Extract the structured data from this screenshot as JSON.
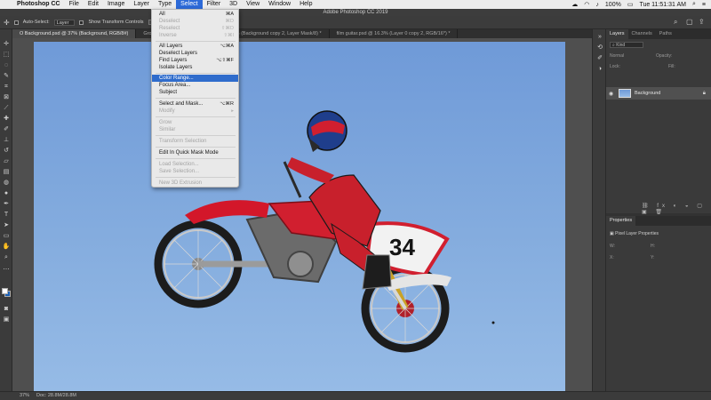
{
  "menubar": {
    "app_name": "Photoshop CC",
    "items": [
      "File",
      "Edit",
      "Image",
      "Layer",
      "Type",
      "Select",
      "Filter",
      "3D",
      "View",
      "Window",
      "Help"
    ],
    "active": "Select",
    "battery": "100%",
    "clock": "Tue 11:51:31 AM"
  },
  "window_title": "Adobe Photoshop CC 2019",
  "options_bar": {
    "auto_select_label": "Auto-Select:",
    "auto_select_value": "Layer",
    "transform_controls_label": "Show Transform Controls"
  },
  "doc_tabs": [
    "O Background.psd @ 37% (Background, RGB/8#)",
    "Group 1...",
    "gameofthrones.psd @ 20% (Background copy 2, Layer Mask/8) *",
    "film guitar.psd @ 16.3% (Layer 0 copy 2, RGB/16*) *"
  ],
  "select_menu": {
    "items": [
      {
        "label": "All",
        "shortcut": "⌘A",
        "enabled": true
      },
      {
        "label": "Deselect",
        "shortcut": "⌘D",
        "enabled": false
      },
      {
        "label": "Reselect",
        "shortcut": "⇧⌘D",
        "enabled": false
      },
      {
        "label": "Inverse",
        "shortcut": "⇧⌘I",
        "enabled": false
      },
      {
        "label": "All Layers",
        "shortcut": "⌥⌘A",
        "enabled": true
      },
      {
        "label": "Deselect Layers",
        "shortcut": "",
        "enabled": true
      },
      {
        "label": "Find Layers",
        "shortcut": "⌥⇧⌘F",
        "enabled": true
      },
      {
        "label": "Isolate Layers",
        "shortcut": "",
        "enabled": true
      },
      {
        "label": "Color Range...",
        "shortcut": "",
        "enabled": true,
        "highlighted": true
      },
      {
        "label": "Focus Area...",
        "shortcut": "",
        "enabled": true
      },
      {
        "label": "Subject",
        "shortcut": "",
        "enabled": true
      },
      {
        "label": "Select and Mask...",
        "shortcut": "⌥⌘R",
        "enabled": true
      },
      {
        "label": "Modify",
        "shortcut": "▸",
        "enabled": false
      },
      {
        "label": "Grow",
        "shortcut": "",
        "enabled": false
      },
      {
        "label": "Similar",
        "shortcut": "",
        "enabled": false
      },
      {
        "label": "Transform Selection",
        "shortcut": "",
        "enabled": false
      },
      {
        "label": "Edit In Quick Mask Mode",
        "shortcut": "",
        "enabled": true
      },
      {
        "label": "Load Selection...",
        "shortcut": "",
        "enabled": false
      },
      {
        "label": "Save Selection...",
        "shortcut": "",
        "enabled": false
      },
      {
        "label": "New 3D Extrusion",
        "shortcut": "",
        "enabled": false
      }
    ]
  },
  "layers_panel": {
    "tabs": [
      "Layers",
      "Channels",
      "Paths"
    ],
    "active_tab": "Layers",
    "kind_filter": "Kind",
    "blend_mode": "Normal",
    "opacity_label": "Opacity:",
    "lock_label": "Lock:",
    "fill_label": "Fill:",
    "layer_name": "Background"
  },
  "properties_panel": {
    "title": "Properties",
    "subtitle": "Pixel Layer Properties",
    "w_label": "W:",
    "h_label": "H:",
    "x_label": "X:",
    "y_label": "Y:"
  },
  "rider_number": "34",
  "status_bar": {
    "zoom": "37%",
    "doc_info": "Doc: 28.8M/28.8M"
  }
}
